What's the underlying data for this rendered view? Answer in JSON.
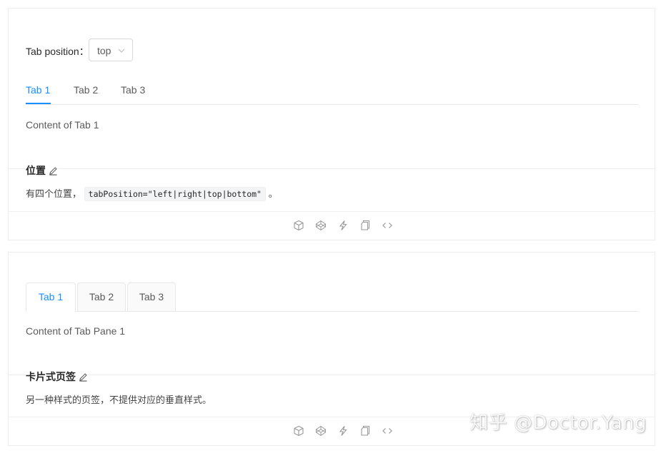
{
  "demo1": {
    "position_label": "Tab position：",
    "select_value": "top",
    "tabs": [
      {
        "label": "Tab 1",
        "active": true
      },
      {
        "label": "Tab 2",
        "active": false
      },
      {
        "label": "Tab 3",
        "active": false
      }
    ],
    "content": "Content of Tab 1",
    "meta_title": "位置",
    "meta_desc_prefix": "有四个位置，",
    "meta_code": "tabPosition=\"left|right|top|bottom\"",
    "meta_desc_suffix": "。"
  },
  "demo2": {
    "tabs": [
      {
        "label": "Tab 1",
        "active": true
      },
      {
        "label": "Tab 2",
        "active": false
      },
      {
        "label": "Tab 3",
        "active": false
      }
    ],
    "content": "Content of Tab Pane 1",
    "meta_title": "卡片式页签",
    "meta_desc": "另一种样式的页签，不提供对应的垂直样式。"
  },
  "actions": [
    "codesandbox-icon",
    "codepen-icon",
    "riddle-icon",
    "copy-icon",
    "code-expand-icon"
  ],
  "watermark": "知乎 @Doctor.Yang",
  "colors": {
    "primary": "#1890ff",
    "border": "#ebedf0",
    "card_tab_bg": "#fafafa"
  }
}
